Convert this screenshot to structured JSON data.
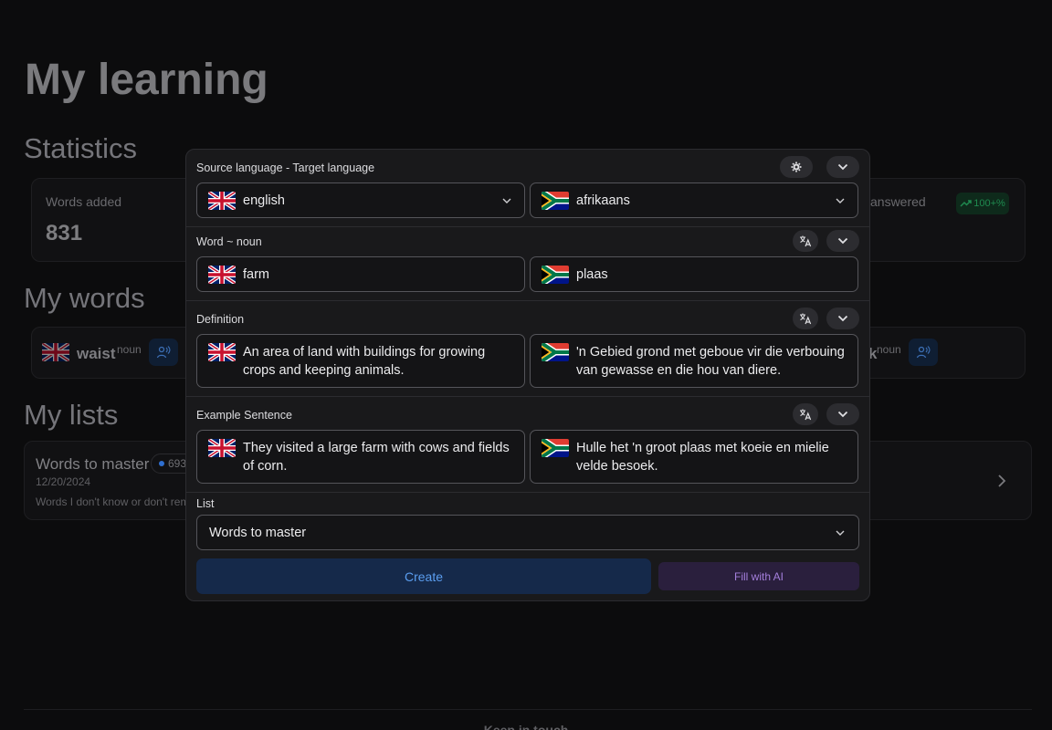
{
  "page": {
    "title": "My learning",
    "statistics_title": "Statistics",
    "words_title": "My words",
    "lists_title": "My lists",
    "footer_text": "Keep in touch"
  },
  "stats": {
    "words_added_label": "Words added",
    "words_added_value": "831",
    "answered_label": "answered",
    "trend_badge": "100+%"
  },
  "words": [
    {
      "word": "waist",
      "pos": "noun"
    },
    {
      "word": "k",
      "pos": "noun"
    }
  ],
  "lists": [
    {
      "name": "Words to master",
      "count": "693",
      "date": "12/20/2024",
      "description": "Words I don't know or don't rem"
    }
  ],
  "modal": {
    "language_section_label": "Source language - Target language",
    "source_language": "english",
    "target_language": "afrikaans",
    "word_section_label": "Word ~ noun",
    "word_source": "farm",
    "word_target": "plaas",
    "definition_label": "Definition",
    "definition_source": "An area of land with buildings for growing crops and keeping animals.",
    "definition_target": "'n Gebied grond met geboue vir die verbouing van gewasse en die hou van diere.",
    "example_label": "Example Sentence",
    "example_source": "They visited a large farm with cows and fields of corn.",
    "example_target": "Hulle het 'n groot plaas met koeie en mielie velde besoek.",
    "list_label": "List",
    "list_value": "Words to master",
    "create_label": "Create",
    "ai_label": "Fill with AI"
  },
  "icons": {
    "settings": "gear-icon",
    "collapse": "chevron-down-icon",
    "translate": "translate-icon",
    "speak": "voice-icon",
    "next": "chevron-right-icon",
    "trend": "trending-up-icon"
  },
  "colors": {
    "background": "#0c0c0d",
    "modal_background": "#19191b",
    "field_border": "#55555a",
    "create_bg": "#15294a",
    "create_text": "#5b9ef0",
    "ai_bg": "#2a1f3d",
    "ai_text": "#a47fdc",
    "trend_green": "#1f8a4f"
  }
}
